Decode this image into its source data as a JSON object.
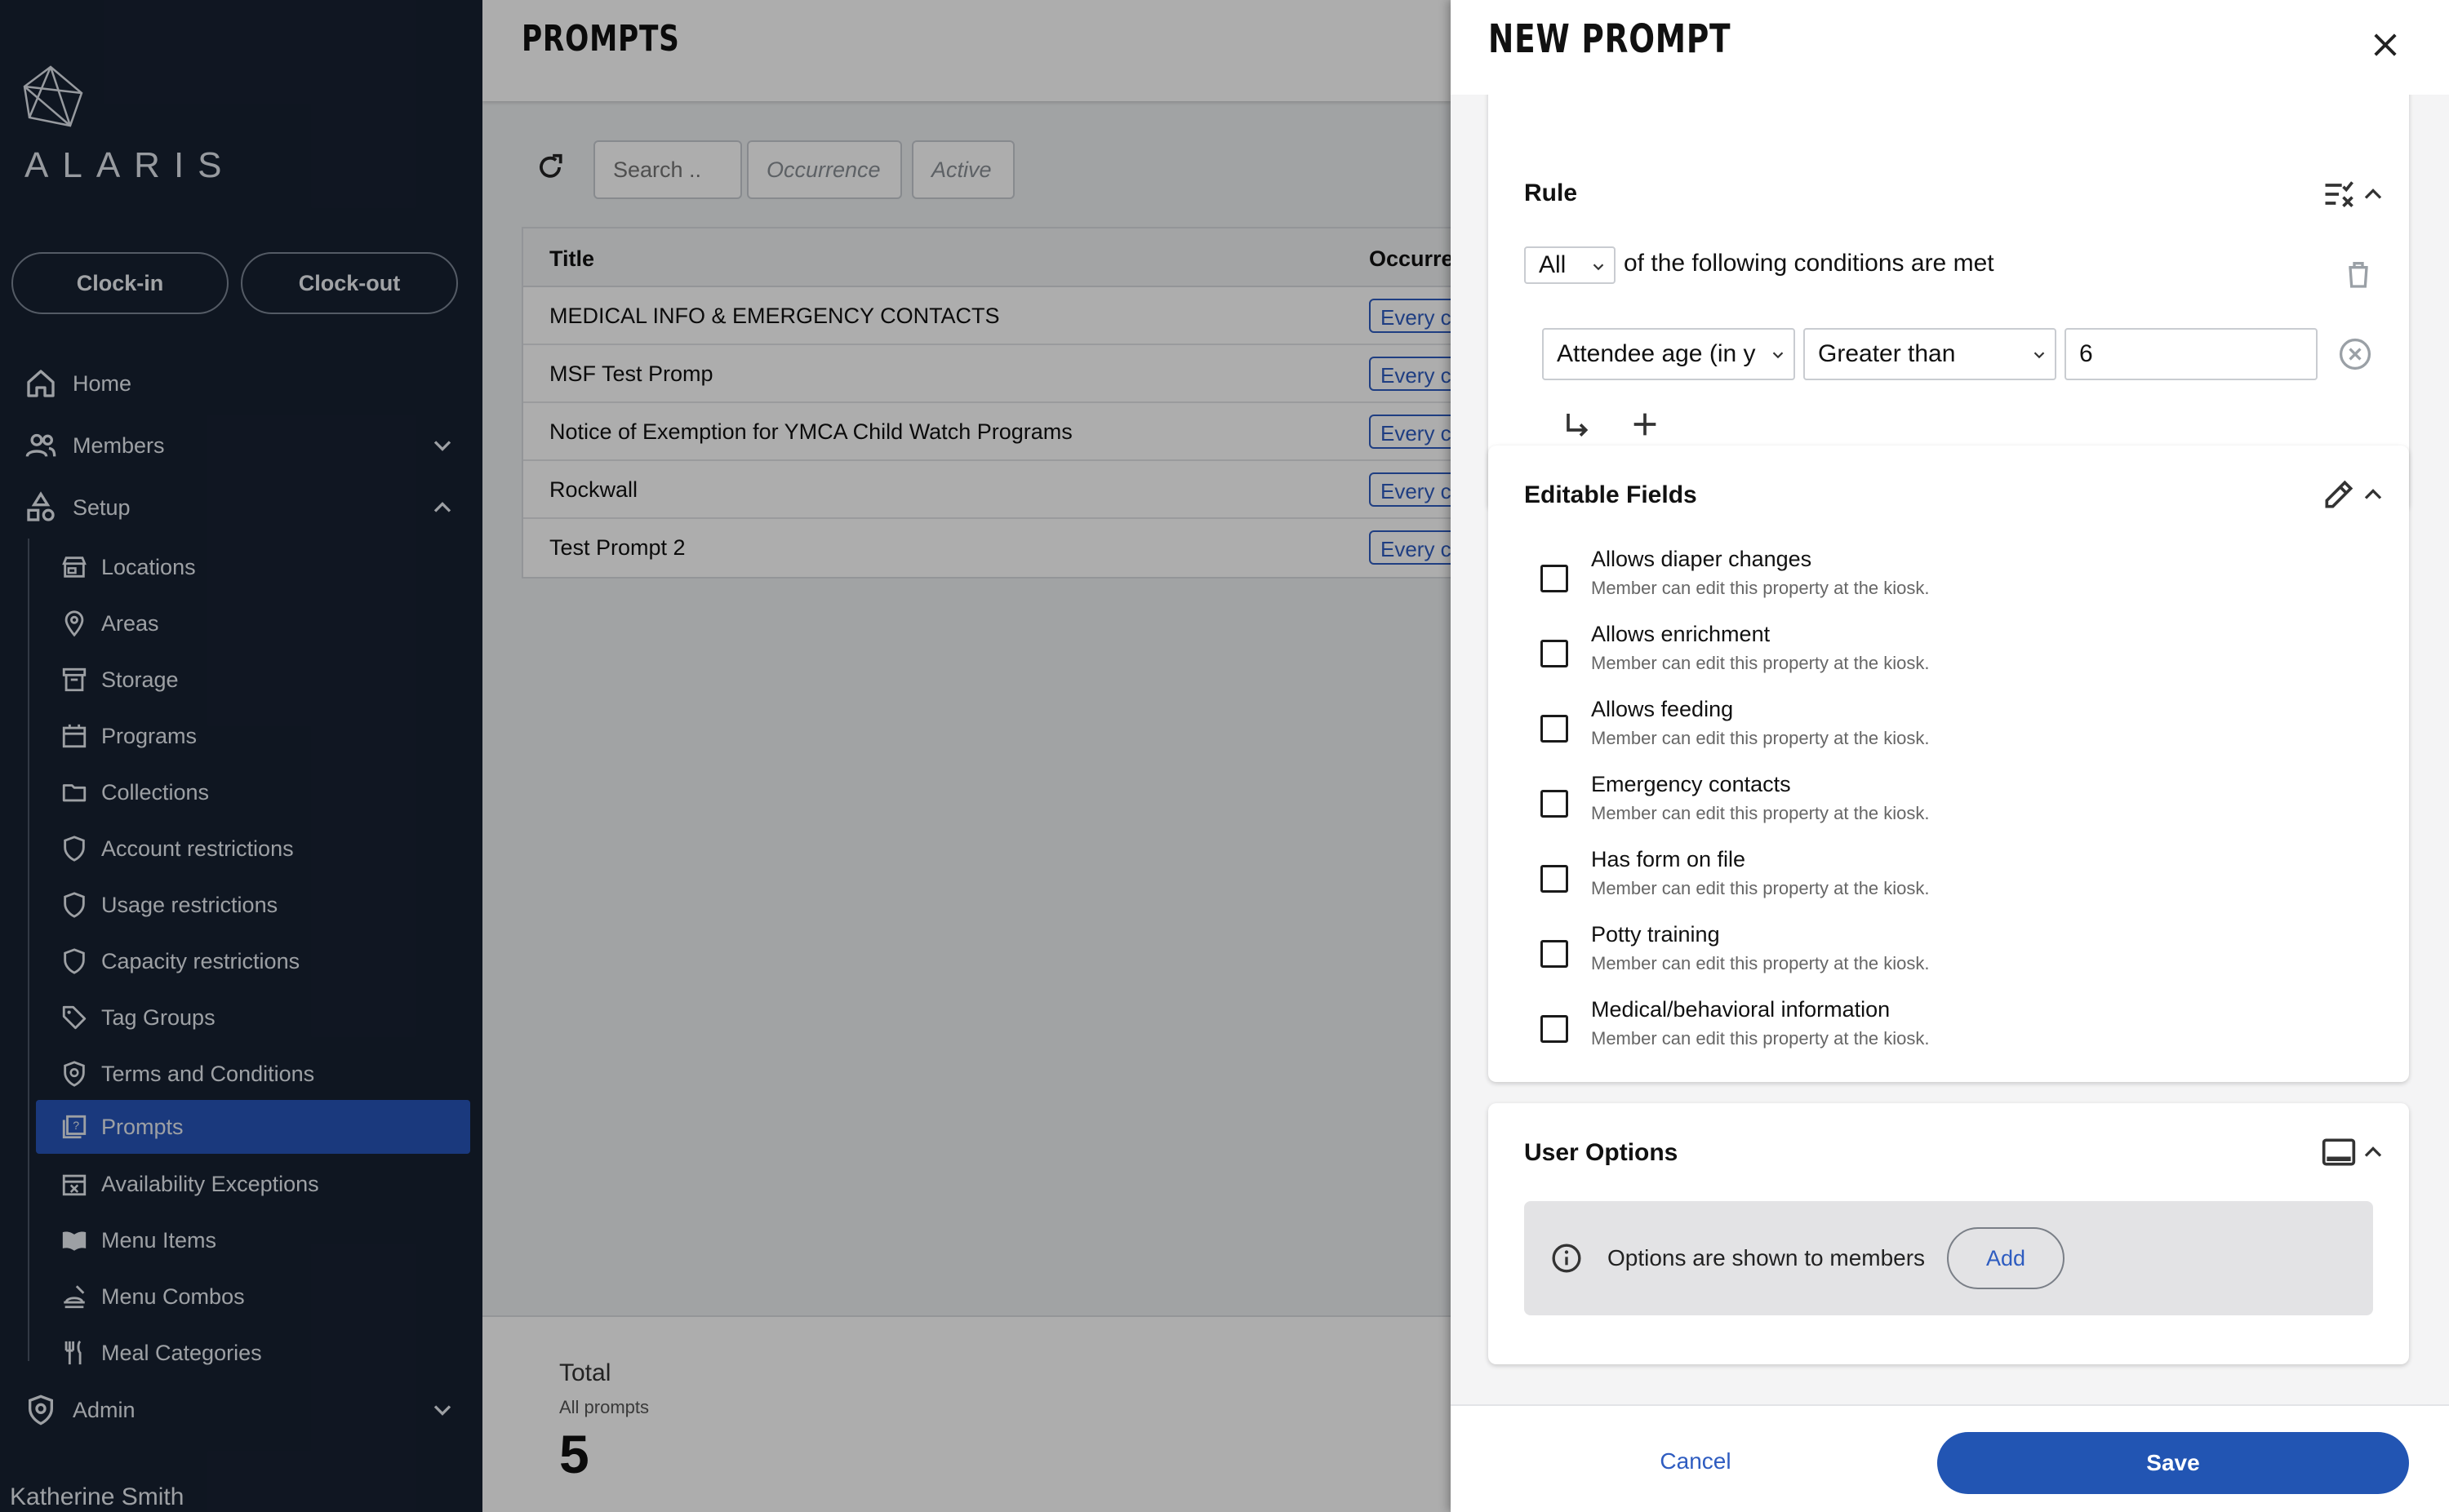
{
  "sidebar": {
    "logo_text": "ALARIS",
    "clock_in": "Clock-in",
    "clock_out": "Clock-out",
    "top_items": [
      {
        "label": "Home",
        "icon": "home-icon"
      },
      {
        "label": "Members",
        "icon": "members-icon",
        "expanded": false
      },
      {
        "label": "Setup",
        "icon": "setup-icon",
        "expanded": true
      }
    ],
    "setup_items": [
      {
        "label": "Locations",
        "icon": "store-icon"
      },
      {
        "label": "Areas",
        "icon": "pin-icon"
      },
      {
        "label": "Storage",
        "icon": "archive-icon"
      },
      {
        "label": "Programs",
        "icon": "calendar-icon"
      },
      {
        "label": "Collections",
        "icon": "folder-icon"
      },
      {
        "label": "Account restrictions",
        "icon": "shield-icon"
      },
      {
        "label": "Usage restrictions",
        "icon": "shield-icon"
      },
      {
        "label": "Capacity restrictions",
        "icon": "shield-icon"
      },
      {
        "label": "Tag Groups",
        "icon": "tag-icon"
      },
      {
        "label": "Terms and Conditions",
        "icon": "policy-icon"
      },
      {
        "label": "Prompts",
        "icon": "prompt-icon",
        "active": true
      },
      {
        "label": "Availability Exceptions",
        "icon": "event-busy-icon"
      },
      {
        "label": "Menu Items",
        "icon": "menu-book-icon"
      },
      {
        "label": "Menu Combos",
        "icon": "dinner-icon"
      },
      {
        "label": "Meal Categories",
        "icon": "utensils-icon"
      }
    ],
    "admin": {
      "label": "Admin",
      "icon": "admin-shield-icon",
      "expanded": false
    },
    "user_name": "Katherine Smith"
  },
  "main": {
    "title": "PROMPTS",
    "search_placeholder": "Search ..",
    "filters": [
      "Occurrence",
      "Active"
    ],
    "columns": [
      "Title",
      "Occurre"
    ],
    "rows": [
      {
        "title": "MEDICAL INFO & EMERGENCY CONTACTS",
        "occurrence": "Every c"
      },
      {
        "title": "MSF Test Promp",
        "occurrence": "Every c"
      },
      {
        "title": "Notice of Exemption for YMCA Child Watch Programs",
        "occurrence": "Every c"
      },
      {
        "title": "Rockwall",
        "occurrence": "Every c"
      },
      {
        "title": "Test Prompt 2",
        "occurrence": "Every c"
      }
    ],
    "total": {
      "label": "Total",
      "sublabel": "All prompts",
      "value": "5"
    }
  },
  "drawer": {
    "title": "NEW PROMPT",
    "rule": {
      "title": "Rule",
      "match_select": "All",
      "match_text": "of the following conditions are met",
      "condition": {
        "field": "Attendee age (in y",
        "operator": "Greater than",
        "value": "6"
      }
    },
    "editable_fields": {
      "title": "Editable Fields",
      "items": [
        {
          "label": "Allows diaper changes",
          "help": "Member can edit this property at the kiosk.",
          "checked": false
        },
        {
          "label": "Allows enrichment",
          "help": "Member can edit this property at the kiosk.",
          "checked": false
        },
        {
          "label": "Allows feeding",
          "help": "Member can edit this property at the kiosk.",
          "checked": false
        },
        {
          "label": "Emergency contacts",
          "help": "Member can edit this property at the kiosk.",
          "checked": false
        },
        {
          "label": "Has form on file",
          "help": "Member can edit this property at the kiosk.",
          "checked": false
        },
        {
          "label": "Potty training",
          "help": "Member can edit this property at the kiosk.",
          "checked": false
        },
        {
          "label": "Medical/behavioral information",
          "help": "Member can edit this property at the kiosk.",
          "checked": false
        }
      ]
    },
    "user_options": {
      "title": "User Options",
      "info_text": "Options are shown to members",
      "add_label": "Add"
    },
    "footer": {
      "cancel": "Cancel",
      "save": "Save"
    }
  },
  "colors": {
    "sidebar_bg": "#172132",
    "active_nav": "#2755b8",
    "primary": "#2255b3",
    "link": "#2e5cc0"
  }
}
